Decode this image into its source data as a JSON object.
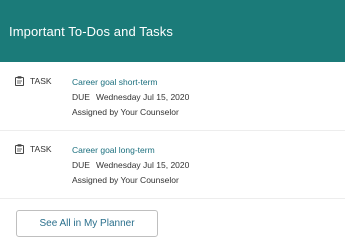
{
  "header": {
    "title": "Important To-Dos and Tasks"
  },
  "tasks": [
    {
      "icon": "clipboard-icon",
      "type": "TASK",
      "title": "Career goal short-term",
      "due_label": "DUE",
      "due_date": "Wednesday Jul 15, 2020",
      "assigned": "Assigned by Your Counselor"
    },
    {
      "icon": "clipboard-icon",
      "type": "TASK",
      "title": "Career goal long-term",
      "due_label": "DUE",
      "due_date": "Wednesday Jul 15, 2020",
      "assigned": "Assigned by Your Counselor"
    }
  ],
  "footer": {
    "button_label": "See All in My Planner"
  },
  "colors": {
    "header_bg": "#1b7b79",
    "link": "#1b6f7e"
  }
}
